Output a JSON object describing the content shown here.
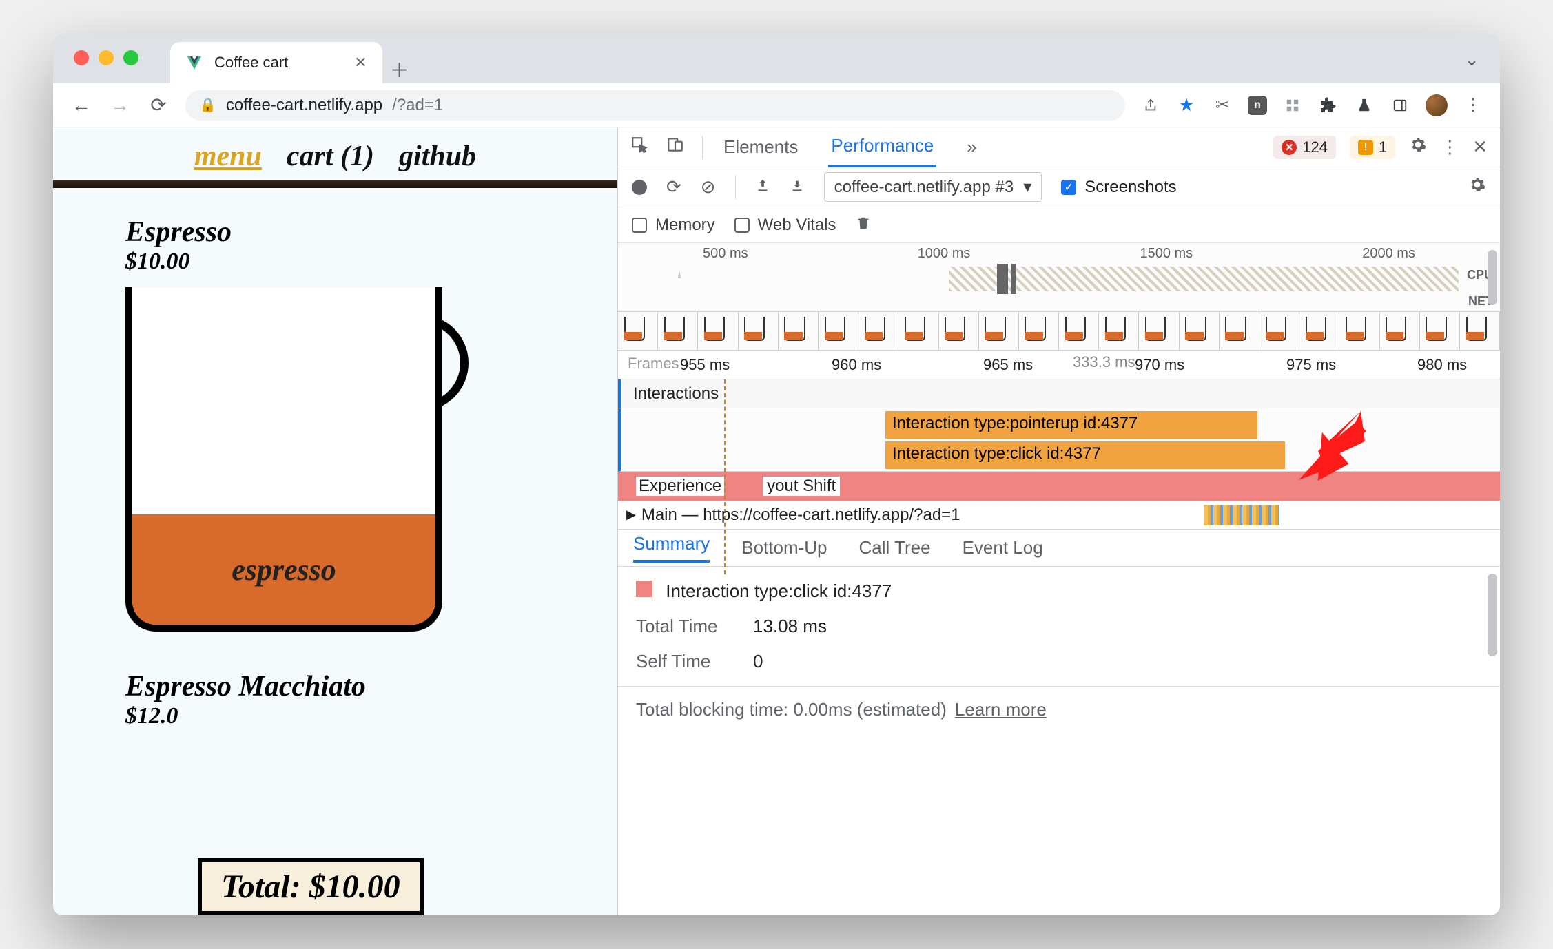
{
  "browser": {
    "tab_title": "Coffee cart",
    "url_domain": "coffee-cart.netlify.app",
    "url_path": "/?ad=1"
  },
  "site": {
    "nav": {
      "menu": "menu",
      "cart": "cart (1)",
      "github": "github"
    },
    "product1": {
      "name": "Espresso",
      "price": "$10.00",
      "fill": "espresso"
    },
    "product2": {
      "name": "Espresso Macchiato",
      "price": "$12.0"
    },
    "total": "Total: $10.00"
  },
  "devtools": {
    "tabs": {
      "elements": "Elements",
      "performance": "Performance",
      "more": "»"
    },
    "errors": "124",
    "warnings": "1",
    "recording_select": "coffee-cart.netlify.app #3",
    "screenshots_label": "Screenshots",
    "memory_label": "Memory",
    "webvitals_label": "Web Vitals",
    "overview_ticks": [
      "500 ms",
      "1000 ms",
      "1500 ms",
      "2000 ms"
    ],
    "overview_cpu": "CPU",
    "overview_net": "NET",
    "ruler": {
      "frames": "Frames",
      "fps": "333.3 ms",
      "ticks": [
        "955 ms",
        "960 ms",
        "965 ms",
        "970 ms",
        "975 ms",
        "980 ms"
      ]
    },
    "interactions_label": "Interactions",
    "interaction_bars": [
      "Interaction type:pointerup id:4377",
      "Interaction type:click id:4377"
    ],
    "experience_row": {
      "prefix": "Experience",
      "suffix": "yout Shift"
    },
    "main_row": "Main — https://coffee-cart.netlify.app/?ad=1",
    "bottom_tabs": [
      "Summary",
      "Bottom-Up",
      "Call Tree",
      "Event Log"
    ],
    "summary": {
      "title": "Interaction type:click id:4377",
      "total_k": "Total Time",
      "total_v": "13.08 ms",
      "self_k": "Self Time",
      "self_v": "0"
    },
    "tbt": {
      "text": "Total blocking time: 0.00ms (estimated)",
      "link": "Learn more"
    }
  }
}
